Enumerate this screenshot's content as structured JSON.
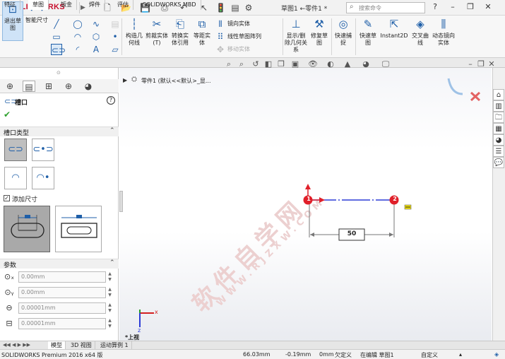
{
  "app": {
    "logo": "SOLIDWORKS",
    "doc_title": "草图1 ←零件1 *",
    "search_placeholder": "搜索命令"
  },
  "quick_access": [
    "new-icon",
    "open-icon",
    "save-icon",
    "print-icon",
    "undo-icon",
    "select-icon",
    "rebuild-icon",
    "file-properties-icon",
    "options-icon"
  ],
  "ribbon": {
    "exit_sketch": "退出草图",
    "smart_dim": "智能尺寸",
    "construction": "构造几何线",
    "trim": "剪裁实体(T)",
    "convert": "转换实体引用",
    "offset": "等距实体",
    "mirror": "镜向实体",
    "linear_pattern": "线性草图阵列",
    "move": "移动实体",
    "show_hide": "显示/删除几何关系",
    "repair": "修复草图",
    "quick_snap": "快速捕捉",
    "rapid_sketch": "快速草图",
    "instant2d": "Instant2D",
    "intersection": "交叉曲线",
    "dynamic_mirror": "动态镜向实体"
  },
  "tabs": [
    "特征",
    "草图",
    "钣金",
    "焊件",
    "评估",
    "SOLIDWORKS MBD"
  ],
  "active_tab": "草图",
  "tree": {
    "label": "零件1 (默认<<默认>_显..."
  },
  "property_manager": {
    "title": "槽口",
    "help": "?",
    "slot_type_title": "槽口类型",
    "add_dim_label": "添加尺寸",
    "add_dim_checked": true,
    "params_title": "参数",
    "params": [
      {
        "icon": "x-center-icon",
        "value": "0.00mm"
      },
      {
        "icon": "y-center-icon",
        "value": "0.00mm"
      },
      {
        "icon": "slot-width-icon",
        "value": "0.00001mm"
      },
      {
        "icon": "slot-length-icon",
        "value": "0.00001mm"
      }
    ]
  },
  "sketch": {
    "dimension": "50",
    "point1_label": "1",
    "point2_label": "2"
  },
  "triad": {
    "x_label": "x",
    "z_label": "z",
    "view_label": "*上视"
  },
  "watermark": {
    "cn": "软件自学网",
    "en": "WWW.RJZXW.COM"
  },
  "bottom_tabs": [
    "模型",
    "3D 视图",
    "运动算例 1"
  ],
  "active_bottom_tab": "模型",
  "status": {
    "product": "SOLIDWORKS Premium 2016 x64 版",
    "x": "66.03mm",
    "y": "-0.19mm",
    "z": "0mm",
    "state": "欠定义",
    "mode": "在编辑 草图1",
    "units": "自定义"
  }
}
